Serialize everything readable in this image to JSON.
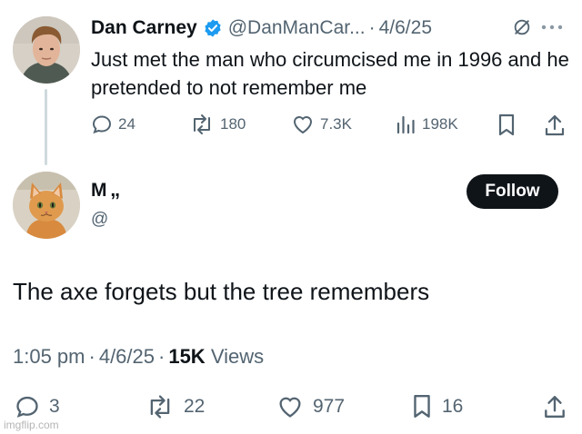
{
  "parent_tweet": {
    "display_name": "Dan Carney",
    "handle": "@DanManCar...",
    "separator": "·",
    "date": "4/6/25",
    "text": "Just met the man who circumcised me in 1996 and he pretended to not remember me",
    "stats": {
      "replies": "24",
      "reposts": "180",
      "likes": "7.3K",
      "views": "198K"
    }
  },
  "reply_tweet": {
    "display_name_partial": "M      ,,",
    "handle_partial": "@",
    "follow_label": "Follow",
    "text": "The axe forgets but the tree remembers",
    "time": "1:05 pm",
    "separator": "·",
    "date": "4/6/25",
    "views_count": "15K",
    "views_label": "Views",
    "stats": {
      "replies": "3",
      "reposts": "22",
      "likes": "977",
      "bookmarks": "16"
    }
  },
  "watermark": "imgflip.com",
  "colors": {
    "text_primary": "#0f1419",
    "text_secondary": "#536471",
    "verified_blue": "#1d9bf0",
    "thread_line": "#cfd9de",
    "follow_button_bg": "#0f1419"
  }
}
